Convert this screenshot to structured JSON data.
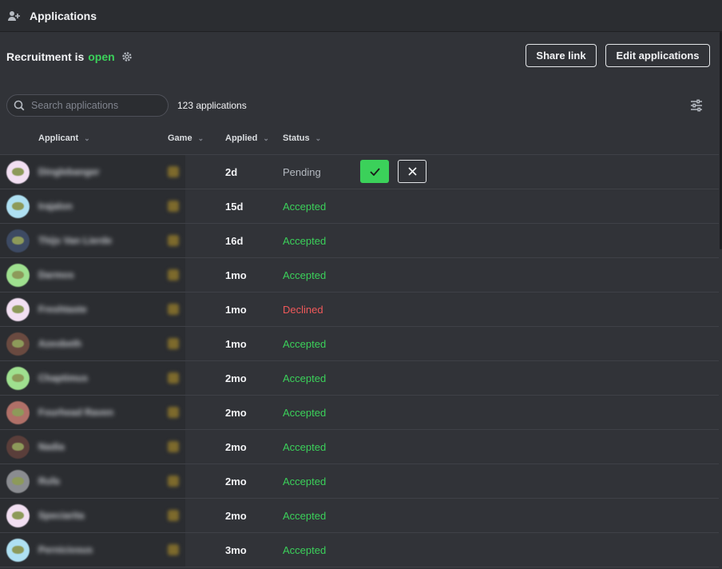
{
  "title": "Applications",
  "recruitment": {
    "label": "Recruitment is",
    "state": "open"
  },
  "buttons": {
    "share": "Share link",
    "edit": "Edit applications"
  },
  "search": {
    "placeholder": "Search applications"
  },
  "count": "123 applications",
  "columns": {
    "applicant": "Applicant",
    "game": "Game",
    "applied": "Applied",
    "status": "Status"
  },
  "colors": {
    "accent_green": "#3bd15a",
    "declined_red": "#f0595a",
    "background": "#313338"
  },
  "rows": [
    {
      "name": "Dinglebanger",
      "applied": "2d",
      "status": "Pending",
      "avatar": "#f2dff2",
      "actions": true
    },
    {
      "name": "Irajalon",
      "applied": "15d",
      "status": "Accepted",
      "avatar": "#aee0f2"
    },
    {
      "name": "Thijs Van Lierde",
      "applied": "16d",
      "status": "Accepted",
      "avatar": "#3d4a63"
    },
    {
      "name": "Darmos",
      "applied": "1mo",
      "status": "Accepted",
      "avatar": "#9fe08f"
    },
    {
      "name": "Freshtaste",
      "applied": "1mo",
      "status": "Declined",
      "avatar": "#f2dff2"
    },
    {
      "name": "Azeobeth",
      "applied": "1mo",
      "status": "Accepted",
      "avatar": "#6a4a40"
    },
    {
      "name": "Chaptimus",
      "applied": "2mo",
      "status": "Accepted",
      "avatar": "#9fe08f"
    },
    {
      "name": "Fourhead Raven",
      "applied": "2mo",
      "status": "Accepted",
      "avatar": "#b07068"
    },
    {
      "name": "Nadia",
      "applied": "2mo",
      "status": "Accepted",
      "avatar": "#5a3e3a"
    },
    {
      "name": "Rufa",
      "applied": "2mo",
      "status": "Accepted",
      "avatar": "#8a8c90"
    },
    {
      "name": "Speciarita",
      "applied": "2mo",
      "status": "Accepted",
      "avatar": "#f2dff2"
    },
    {
      "name": "Perniciosus",
      "applied": "3mo",
      "status": "Accepted",
      "avatar": "#aee0f2"
    }
  ]
}
